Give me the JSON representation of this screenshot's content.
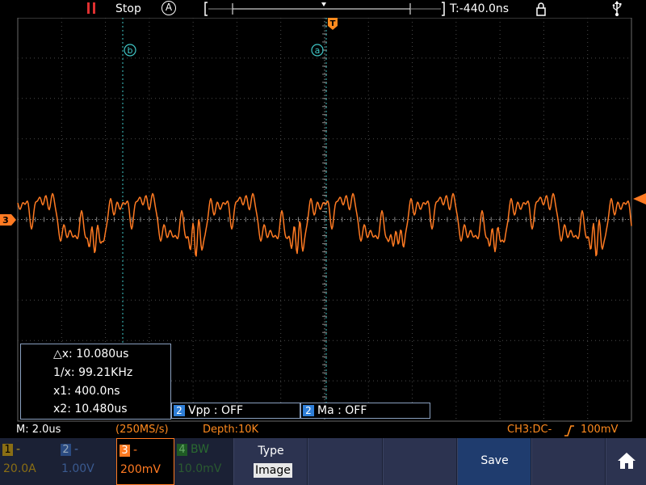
{
  "topbar": {
    "run_state": "Stop",
    "trigger_mode": "A",
    "trigger_time": "T:-440.0ns",
    "icons": [
      "pause-icon",
      "auto-trigger-icon",
      "lock-icon",
      "usb-icon"
    ]
  },
  "plot": {
    "cursor_b_label": "b",
    "cursor_a_label": "a",
    "trigger_marker_label": "T",
    "channel_marker_label": "3"
  },
  "cursor_readout": {
    "dx": "△x: 10.080us",
    "inv_dx": "1/x: 99.21KHz",
    "x1": "x1: 400.0ns",
    "x2": "x2: 10.480us"
  },
  "measurements": [
    {
      "num": "2",
      "text": "Vpp : OFF"
    },
    {
      "num": "2",
      "text": "Ma : OFF"
    }
  ],
  "status": {
    "timebase": "M: 2.0us",
    "sample_rate": "(250MS/s)",
    "depth": "Depth:10K",
    "trigger_info": "CH3:DC-",
    "trigger_level": "100mV"
  },
  "menu": {
    "channels": [
      {
        "num": "1",
        "head": "-",
        "value": "20.0A",
        "color": "#b8961e"
      },
      {
        "num": "2",
        "head": "-",
        "value": "1.00V",
        "color": "#4a70b0"
      },
      {
        "num": "3",
        "head": "-",
        "value": "200mV",
        "color": "#ff7a22"
      },
      {
        "num": "4",
        "head": "BW",
        "value": "10.0mV",
        "color": "#3aa040"
      }
    ],
    "type_label": "Type",
    "type_value": "Image",
    "save_label": "Save",
    "home_icon": "home-icon"
  },
  "colors": {
    "waveform": "#ff7a22",
    "cursor": "#40c8c8",
    "accent_blue": "#2f7fd8"
  }
}
